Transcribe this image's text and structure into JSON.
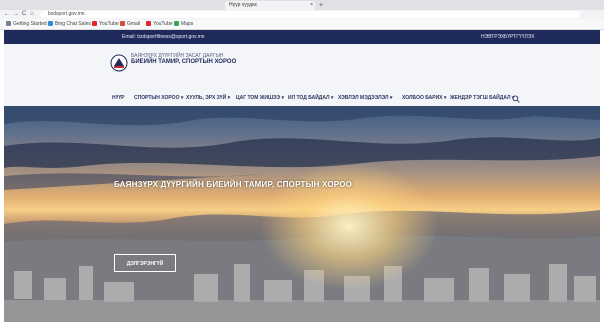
{
  "browser": {
    "tab_title": "Нүүр хуудас",
    "address": "bzdsport.gov.mn",
    "bookmarks": [
      "Getting Started",
      "Bing Chat Sales",
      "YouTube",
      "Gmail",
      "YouTube",
      "Maps"
    ],
    "new_tab": "+",
    "back": "←",
    "forward": "→",
    "reload": "C",
    "home": "⌂",
    "close": "×"
  },
  "topbar": {
    "email": "Email: bzdsportfitness@sport.gov.mn",
    "links": [
      "НЭВТРЭХ",
      "БҮРТГҮҮЛЭХ"
    ]
  },
  "org": {
    "subtitle": "БАЯНЗҮРХ ДҮҮРГИЙН ЗАСАГ ДАРГЫН",
    "name": "БИЕИЙН ТАМИР, СПОРТЫН ХОРОО"
  },
  "menu": [
    "НҮҮР",
    "СПОРТЫН ХОРОО ▾",
    "ХУУЛЬ, ЭРХ ЗҮЙ ▾",
    "ЦАГ ТОМ ЖИШЭЭ ▾",
    "ИЛ ТОД БАЙДАЛ ▾",
    "ХЭВЛЭЛ МЭДЭЭЛЭЛ ▾",
    "ХОЛБОО БАРИХ ▾",
    "ЖЕНДЭР ТЭГШ БАЙДАЛ ▾"
  ],
  "hero": {
    "title": "БАЯНЗҮРХ ДҮҮРГИЙН БИЕИЙН ТАМИР, СПОРТЫН ХОРОО",
    "button": "ДЭЛГЭРЭНГҮЙ"
  },
  "colors": {
    "navy": "#1e2a5a",
    "accent": "#f6cf86"
  }
}
